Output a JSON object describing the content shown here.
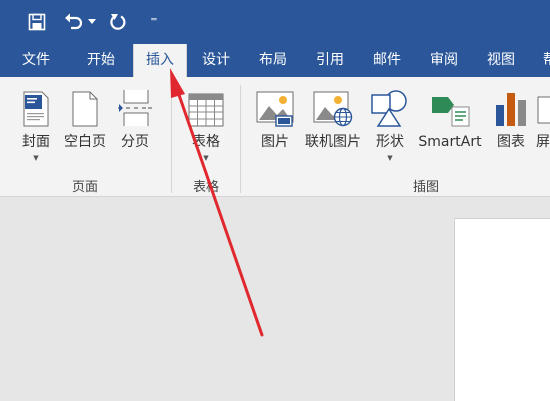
{
  "quick_access": {
    "save_icon": "save-icon",
    "undo_icon": "undo-icon",
    "undo_dropdown_icon": "chevron-down-icon",
    "redo_icon": "redo-icon",
    "customize_icon": "customize-quick-access-icon",
    "customize_glyph": "⁼"
  },
  "tabs": [
    {
      "label": "文件"
    },
    {
      "label": "开始"
    },
    {
      "label": "插入"
    },
    {
      "label": "设计"
    },
    {
      "label": "布局"
    },
    {
      "label": "引用"
    },
    {
      "label": "邮件"
    },
    {
      "label": "审阅"
    },
    {
      "label": "视图"
    },
    {
      "label": "帮"
    }
  ],
  "active_tab": "插入",
  "ribbon": {
    "groups": {
      "pages": {
        "label": "页面",
        "buttons": {
          "cover": {
            "label": "封面",
            "icon": "cover-page-icon"
          },
          "blank": {
            "label": "空白页",
            "icon": "blank-page-icon"
          },
          "break": {
            "label": "分页",
            "icon": "page-break-icon"
          }
        }
      },
      "tables": {
        "label": "表格",
        "buttons": {
          "table": {
            "label": "表格",
            "icon": "table-icon"
          }
        }
      },
      "illustrations": {
        "label": "插图",
        "buttons": {
          "picture": {
            "label": "图片",
            "icon": "picture-icon"
          },
          "online_picture": {
            "label": "联机图片",
            "icon": "online-picture-icon"
          },
          "shapes": {
            "label": "形状",
            "icon": "shapes-icon"
          },
          "smartart": {
            "label": "SmartArt",
            "icon": "smartart-icon"
          },
          "chart": {
            "label": "图表",
            "icon": "chart-icon"
          },
          "screenshot": {
            "label": "屏",
            "icon": "screenshot-icon"
          }
        }
      }
    },
    "dropdown_caret": "▼"
  },
  "annotation": {
    "icon": "red-arrow-pointer",
    "color": "#e0282e"
  },
  "colors": {
    "accent": "#2b579a",
    "ribbon_bg": "#f3f3f3",
    "canvas_bg": "#e6e6e6"
  }
}
